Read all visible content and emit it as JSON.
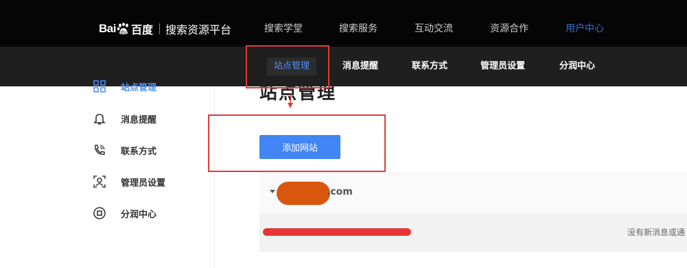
{
  "header": {
    "logo_text": "Bai",
    "logo_du": "百度",
    "platform_title": "搜索资源平台",
    "nav": [
      {
        "label": "搜索学堂"
      },
      {
        "label": "搜索服务"
      },
      {
        "label": "互动交流"
      },
      {
        "label": "资源合作"
      },
      {
        "label": "用户中心"
      }
    ],
    "active_nav_color": "#3c6fd1"
  },
  "subnav": [
    {
      "label": "站点管理"
    },
    {
      "label": "消息提醒"
    },
    {
      "label": "联系方式"
    },
    {
      "label": "管理员设置"
    },
    {
      "label": "分润中心"
    }
  ],
  "sidebar": {
    "items": [
      {
        "label": "站点管理",
        "icon": "grid-icon"
      },
      {
        "label": "消息提醒",
        "icon": "bell-icon"
      },
      {
        "label": "联系方式",
        "icon": "phone-icon"
      },
      {
        "label": "管理员设置",
        "icon": "admin-icon"
      },
      {
        "label": "分润中心",
        "icon": "share-icon"
      }
    ]
  },
  "main": {
    "title": "站点管理",
    "add_site_label": "添加网站",
    "site_domain_suffix": ".com",
    "status_text": "没有新消息或通"
  },
  "colors": {
    "accent": "#4285f4",
    "annotation_red": "#e23a3a",
    "topbar": "#050505",
    "subbar": "#1f1f1f"
  }
}
